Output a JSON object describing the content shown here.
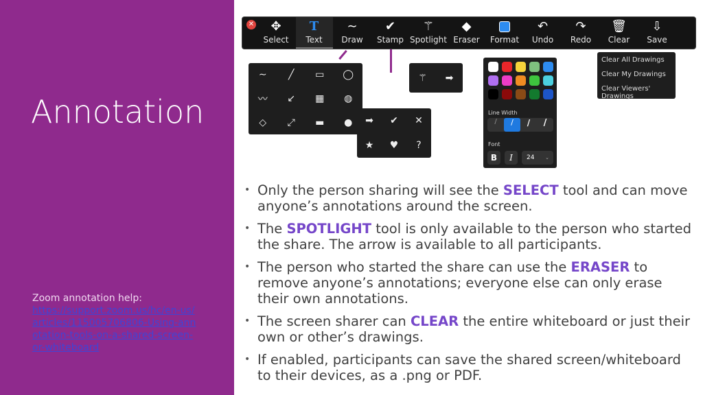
{
  "slide": {
    "title": "Annotation",
    "help_label": "Zoom annotation help:",
    "help_link": "https://support.zoom.us/hc/en-us/articles/115005706806-Using-annotation-tools-on-a-shared-screen-or-whiteboard"
  },
  "toolbar": {
    "items": [
      {
        "label": "Select",
        "icon": "move-arrows-icon",
        "glyph": "✥"
      },
      {
        "label": "Text",
        "icon": "text-T-icon",
        "glyph": "T"
      },
      {
        "label": "Draw",
        "icon": "squiggle-icon",
        "glyph": "∼"
      },
      {
        "label": "Stamp",
        "icon": "checkmark-icon",
        "glyph": "✔"
      },
      {
        "label": "Spotlight",
        "icon": "magic-wand-icon",
        "glyph": "⚚"
      },
      {
        "label": "Eraser",
        "icon": "eraser-icon",
        "glyph": "◆"
      },
      {
        "label": "Format",
        "icon": "color-square-icon",
        "glyph": ""
      },
      {
        "label": "Undo",
        "icon": "undo-icon",
        "glyph": "↶"
      },
      {
        "label": "Redo",
        "icon": "redo-icon",
        "glyph": "↷"
      },
      {
        "label": "Clear",
        "icon": "trash-icon",
        "glyph": "🗑"
      },
      {
        "label": "Save",
        "icon": "save-download-icon",
        "glyph": "⇩"
      }
    ]
  },
  "draw_tools": [
    "∼",
    "╱",
    "▭",
    "◯",
    "〰",
    "↙",
    "▦",
    "◍",
    "◇",
    "⤢",
    "▬",
    "●"
  ],
  "stamp_tools": [
    "➡",
    "✔",
    "✕",
    "★",
    "♥",
    "?"
  ],
  "spotlight_tools": [
    "⚚",
    "➡"
  ],
  "format": {
    "colors": [
      "#ffffff",
      "#e8262a",
      "#f5d33b",
      "#7fc07f",
      "#2e8cf0",
      "#b06ff0",
      "#ec3cc6",
      "#f08c22",
      "#3ec43e",
      "#4cd0e0",
      "#000000",
      "#8b0a0a",
      "#8a4a16",
      "#137a2e",
      "#1d55c8"
    ],
    "line_width_label": "Line Width",
    "font_label": "Font",
    "bold": "B",
    "italic": "I",
    "font_size": "24"
  },
  "clear_menu": [
    "Clear All Drawings",
    "Clear My Drawings",
    "Clear Viewers' Drawings"
  ],
  "bullets": [
    {
      "pre": "Only the person sharing will see the ",
      "key": "SELECT",
      "post": " tool and can move anyone’s annotations around the screen."
    },
    {
      "pre": "The ",
      "key": "SPOTLIGHT",
      "post": " tool is only available to the person who started the share. The arrow is available to all participants."
    },
    {
      "pre": "The person who started the share can use the ",
      "key": "ERASER",
      "post": " to remove anyone’s annotations; everyone else can only erase their own annotations."
    },
    {
      "pre": "The screen sharer can ",
      "key": "CLEAR",
      "post": " the entire whiteboard or just their own or other’s drawings."
    },
    {
      "pre": "If enabled, participants can save the shared screen/whiteboard to their devices, as a .png or PDF.",
      "key": "",
      "post": ""
    }
  ]
}
